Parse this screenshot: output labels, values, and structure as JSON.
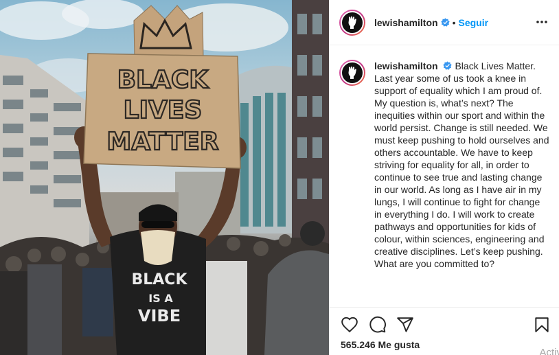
{
  "post": {
    "username": "lewishamilton",
    "separator": "•",
    "follow_label": "Seguir",
    "caption_text": "Black Lives Matter. Last year some of us took a knee in support of equality which I am proud of. My question is, what’s next? The inequities within our sport and within the world persist. Change is still needed. We must keep pushing to hold ourselves and others accountable. We have to keep striving for equality for all, in order to continue to see true and lasting change in our world. As long as I have air in my lungs, I will continue to fight for change in everything I do. I will work to create pathways and opportunities for kids of colour, within sciences, engineering and creative disciplines. Let’s keep pushing. What are you committed to?",
    "likes_label": "565.246 Me gusta"
  },
  "photo": {
    "sign_lines": [
      "BLACK",
      "LIVES",
      "MATTER"
    ],
    "shirt_lines": [
      "BLACK",
      "IS A",
      "VIBE"
    ]
  },
  "icons": {
    "more": "more-options-icon",
    "like": "heart-icon",
    "comment": "comment-icon",
    "share": "share-icon",
    "save": "bookmark-icon",
    "verified": "verified-badge-icon"
  },
  "overlay": {
    "activate_text": "Activ"
  },
  "colors": {
    "accent": "#0095f6",
    "text": "#262626",
    "border": "#efefef"
  }
}
